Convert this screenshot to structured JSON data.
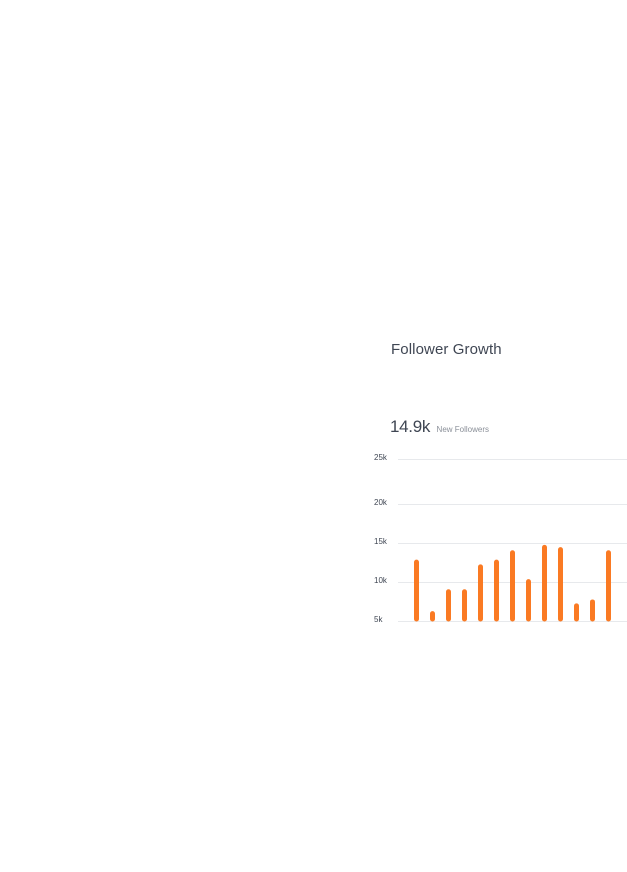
{
  "title": "Follower Growth",
  "metric": {
    "value": "14.9k",
    "label": "New Followers"
  },
  "colors": {
    "bar": "#fa7a23",
    "text": "#3f4653",
    "grid": "#e7e9ec"
  },
  "chart_data": {
    "type": "bar",
    "title": "Follower Growth",
    "xlabel": "",
    "ylabel": "",
    "ylim": [
      5000,
      25000
    ],
    "yticks": [
      {
        "value": 25000,
        "label": "25k"
      },
      {
        "value": 20000,
        "label": "20k"
      },
      {
        "value": 15000,
        "label": "15k"
      },
      {
        "value": 10000,
        "label": "10k"
      },
      {
        "value": 5000,
        "label": "5k"
      }
    ],
    "grid": true,
    "values": [
      12800,
      6200,
      9000,
      9000,
      12200,
      12800,
      14000,
      10300,
      14700,
      14400,
      7200,
      7700,
      14000
    ]
  }
}
